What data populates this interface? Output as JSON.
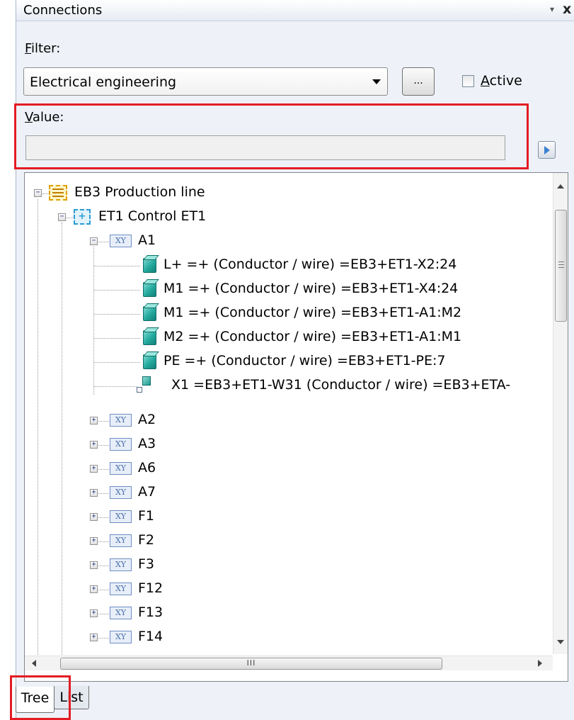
{
  "panel": {
    "title": "Connections",
    "pin_glyph": "▾",
    "close_glyph": "x"
  },
  "filter": {
    "label": "Filter:",
    "selected": "Electrical engineering",
    "more_button": "...",
    "active_label": "Active",
    "active_checked": false
  },
  "value": {
    "label": "Value:",
    "input_value": ""
  },
  "tree": {
    "root": "EB3 Production line",
    "child": "ET1 Control ET1",
    "device_a1": "A1",
    "connections": [
      "L+ =+  (Conductor / wire) =EB3+ET1-X2:24",
      "M1 =+  (Conductor / wire) =EB3+ET1-X4:24",
      "M1 =+  (Conductor / wire) =EB3+ET1-A1:M2",
      "M2 =+  (Conductor / wire) =EB3+ET1-A1:M1",
      "PE =+  (Conductor / wire) =EB3+ET1-PE:7",
      "X1 =EB3+ET1-W31  (Conductor / wire) =EB3+ETA-"
    ],
    "devices": [
      "A2",
      "A3",
      "A6",
      "A7",
      "F1",
      "F2",
      "F3",
      "F12",
      "F13",
      "F14"
    ],
    "xy_badge": "XY",
    "expander_plus": "+",
    "expander_minus": "−"
  },
  "hscroll_grip": "III",
  "tabs": {
    "tree": "Tree",
    "list": "List"
  },
  "colors": {
    "highlight": "#e41c23",
    "panel_bg": "#eef2f8",
    "wire_icon": "#23a99e"
  }
}
